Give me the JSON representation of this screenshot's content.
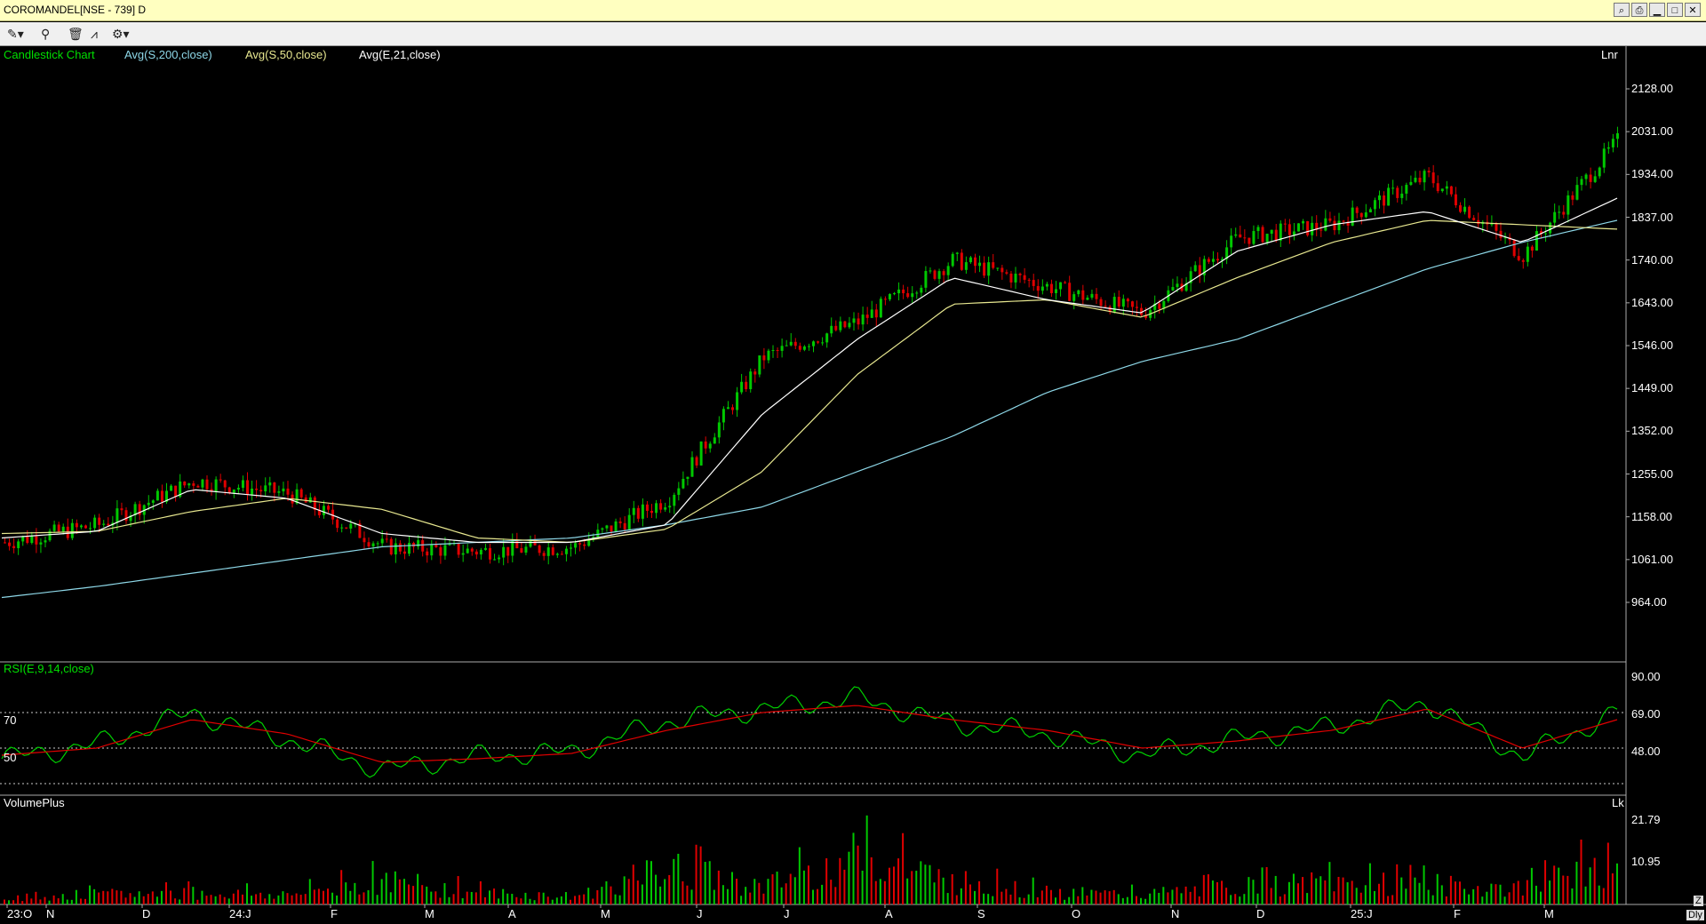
{
  "window": {
    "title": "COROMANDEL[NSE - 739] D"
  },
  "toolbar": {
    "icons": [
      "draw-tools-icon",
      "pin-icon",
      "delete-icon",
      "chart-type-icon",
      "settings-icon"
    ]
  },
  "price_panel": {
    "legend": {
      "chart_type": "Candlestick Chart",
      "ma200": "Avg(S,200,close)",
      "ma50": "Avg(S,50,close)",
      "ema21": "Avg(E,21,close)"
    },
    "scale_mode": "Lnr",
    "axis_labels": [
      "2128.00",
      "2031.00",
      "1934.00",
      "1837.00",
      "1740.00",
      "1643.00",
      "1546.00",
      "1449.00",
      "1352.00",
      "1255.00",
      "1158.00",
      "1061.00",
      "964.00"
    ],
    "colors": {
      "ma200": "#8ed8e8",
      "ma50": "#e8e890",
      "ema21": "#ffffff",
      "up": "#00c800",
      "down": "#e00000"
    }
  },
  "rsi_panel": {
    "legend": "RSI(E,9,14,close)",
    "left_levels": [
      "70",
      "50"
    ],
    "axis_labels": [
      "90.00",
      "69.00",
      "48.00"
    ],
    "colors": {
      "rsi": "#00d000",
      "signal": "#e00000"
    }
  },
  "volume_panel": {
    "legend": "VolumePlus",
    "unit": "Lk",
    "axis_labels": [
      "21.79",
      "10.95"
    ]
  },
  "time_axis": {
    "labels": [
      "23:O",
      "N",
      "D",
      "24:J",
      "F",
      "M",
      "A",
      "M",
      "J",
      "J",
      "A",
      "S",
      "O",
      "N",
      "D",
      "25:J",
      "F",
      "M"
    ],
    "corner_buttons": [
      "Z",
      "Dly"
    ]
  },
  "chart_data": [
    {
      "type": "candlestick",
      "title": "COROMANDEL[NSE - 739] D",
      "x": [
        "2023-10",
        "2023-11",
        "2023-12",
        "2024-01",
        "2024-02",
        "2024-03",
        "2024-04",
        "2024-05",
        "2024-06",
        "2024-07",
        "2024-08",
        "2024-09",
        "2024-10",
        "2024-11",
        "2024-12",
        "2025-01",
        "2025-02",
        "2025-03"
      ],
      "ylim": [
        964,
        2128
      ],
      "series": [
        {
          "name": "Avg(S,200,close)",
          "values": [
            975,
            1000,
            1030,
            1060,
            1090,
            1100,
            1110,
            1140,
            1180,
            1260,
            1340,
            1440,
            1510,
            1560,
            1640,
            1720,
            1780,
            1830
          ]
        },
        {
          "name": "Avg(S,50,close)",
          "values": [
            1120,
            1125,
            1170,
            1200,
            1175,
            1110,
            1100,
            1130,
            1260,
            1480,
            1640,
            1650,
            1610,
            1700,
            1780,
            1830,
            1820,
            1810
          ]
        },
        {
          "name": "Avg(E,21,close)",
          "values": [
            1110,
            1125,
            1220,
            1200,
            1120,
            1100,
            1100,
            1140,
            1390,
            1560,
            1700,
            1650,
            1620,
            1760,
            1820,
            1850,
            1780,
            1880
          ]
        }
      ],
      "close_approx": [
        1100,
        1140,
        1240,
        1210,
        1090,
        1080,
        1090,
        1200,
        1520,
        1600,
        1740,
        1680,
        1620,
        1790,
        1820,
        1930,
        1750,
        2010
      ]
    },
    {
      "type": "line",
      "title": "RSI(E,9,14,close)",
      "ylim": [
        27,
        90
      ],
      "reference_lines": [
        70,
        50
      ],
      "x": [
        "2023-10",
        "2023-11",
        "2023-12",
        "2024-01",
        "2024-02",
        "2024-03",
        "2024-04",
        "2024-05",
        "2024-06",
        "2024-07",
        "2024-08",
        "2024-09",
        "2024-10",
        "2024-11",
        "2024-12",
        "2025-01",
        "2025-02",
        "2025-03"
      ],
      "series": [
        {
          "name": "RSI",
          "values": [
            44,
            52,
            70,
            55,
            38,
            45,
            48,
            65,
            72,
            78,
            64,
            58,
            46,
            55,
            62,
            76,
            45,
            70
          ]
        },
        {
          "name": "Signal",
          "values": [
            46,
            50,
            66,
            58,
            42,
            44,
            47,
            60,
            70,
            74,
            66,
            60,
            50,
            54,
            60,
            72,
            50,
            66
          ]
        }
      ]
    },
    {
      "type": "bar",
      "title": "VolumePlus",
      "ylim": [
        0,
        24
      ],
      "x": [
        "2023-10",
        "2023-11",
        "2023-12",
        "2024-01",
        "2024-02",
        "2024-03",
        "2024-04",
        "2024-05",
        "2024-06",
        "2024-07",
        "2024-08",
        "2024-09",
        "2024-10",
        "2024-11",
        "2024-12",
        "2025-01",
        "2025-02",
        "2025-03"
      ],
      "values": [
        4,
        5,
        6,
        5,
        12,
        6,
        4,
        18,
        9,
        24,
        12,
        6,
        5,
        9,
        11,
        10,
        8,
        22
      ]
    }
  ]
}
